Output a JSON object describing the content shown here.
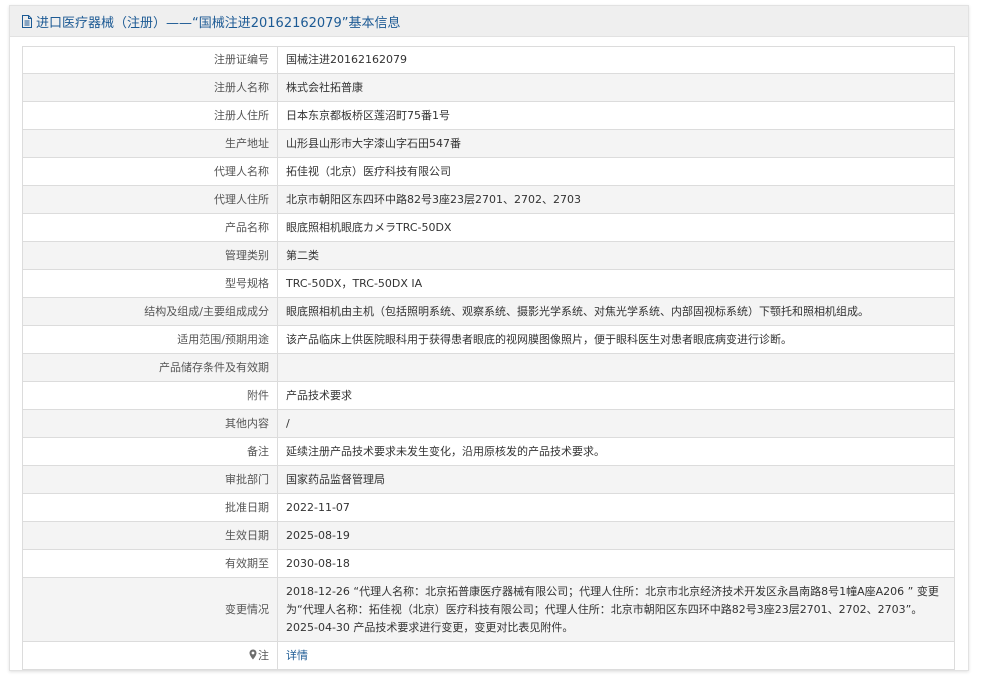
{
  "header": {
    "title": "进口医疗器械（注册）——“国械注进20162162079”基本信息",
    "icon": "document-icon"
  },
  "rows": [
    {
      "label": "注册证编号",
      "value": "国械注进20162162079"
    },
    {
      "label": "注册人名称",
      "value": "株式会社拓普康"
    },
    {
      "label": "注册人住所",
      "value": "日本东京都板桥区莲沼町75番1号"
    },
    {
      "label": "生产地址",
      "value": "山形县山形市大字漆山字石田547番"
    },
    {
      "label": "代理人名称",
      "value": "拓佳视（北京）医疗科技有限公司"
    },
    {
      "label": "代理人住所",
      "value": "北京市朝阳区东四环中路82号3座23层2701、2702、2703"
    },
    {
      "label": "产品名称",
      "value": "眼底照相机眼底カメラTRC-50DX"
    },
    {
      "label": "管理类别",
      "value": "第二类"
    },
    {
      "label": "型号规格",
      "value": "TRC-50DX，TRC-50DX IA"
    },
    {
      "label": "结构及组成/主要组成成分",
      "value": "眼底照相机由主机（包括照明系统、观察系统、摄影光学系统、对焦光学系统、内部固视标系统）下颚托和照相机组成。"
    },
    {
      "label": "适用范围/预期用途",
      "value": "该产品临床上供医院眼科用于获得患者眼底的视网膜图像照片，便于眼科医生对患者眼底病变进行诊断。"
    },
    {
      "label": "产品储存条件及有效期",
      "value": ""
    },
    {
      "label": "附件",
      "value": "产品技术要求"
    },
    {
      "label": "其他内容",
      "value": "/"
    },
    {
      "label": "备注",
      "value": "延续注册产品技术要求未发生变化，沿用原核发的产品技术要求。"
    },
    {
      "label": "审批部门",
      "value": "国家药品监督管理局"
    },
    {
      "label": "批准日期",
      "value": "2022-11-07"
    },
    {
      "label": "生效日期",
      "value": "2025-08-19"
    },
    {
      "label": "有效期至",
      "value": "2030-08-18"
    },
    {
      "label": "变更情况",
      "value": "2018-12-26 “代理人名称：北京拓普康医疗器械有限公司；代理人住所：北京市北京经济技术开发区永昌南路8号1幢A座A206 ” 变更为“代理人名称：拓佳视（北京）医疗科技有限公司；代理人住所：北京市朝阳区东四环中路82号3座23层2701、2702、2703”。2025-04-30 产品技术要求进行变更，变更对比表见附件。"
    }
  ],
  "note": {
    "label": "注",
    "icon": "location-pin-icon",
    "link_text": "详情"
  }
}
